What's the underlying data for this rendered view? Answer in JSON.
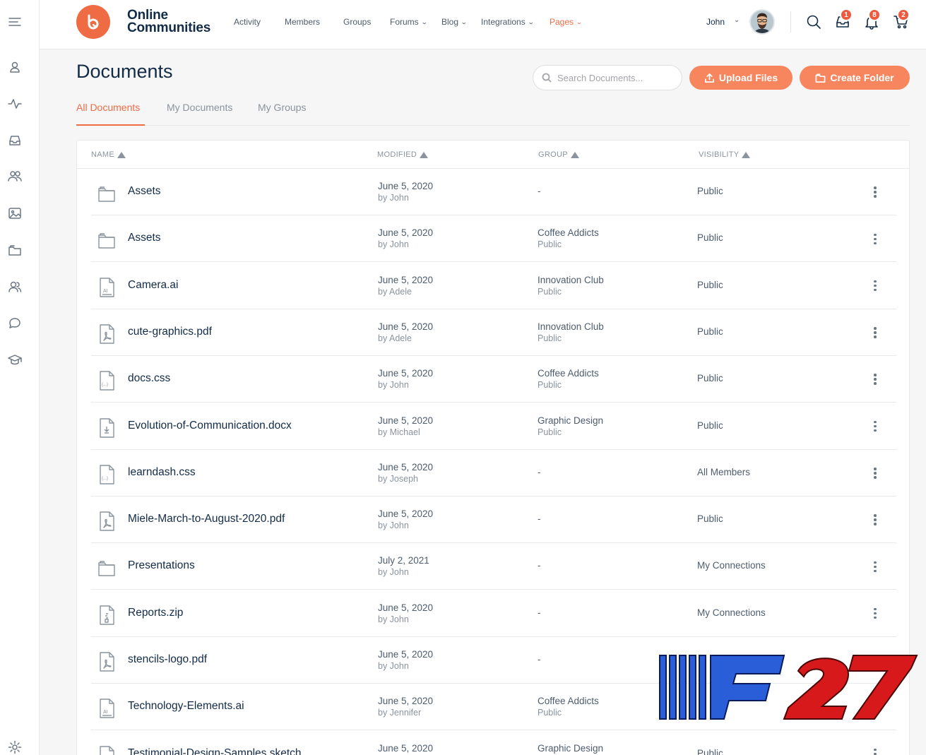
{
  "sidebar": {
    "items": [
      {
        "name": "menu-toggle-icon"
      },
      {
        "name": "profile-icon"
      },
      {
        "name": "activity-icon"
      },
      {
        "name": "inbox-icon"
      },
      {
        "name": "members-icon"
      },
      {
        "name": "photos-icon"
      },
      {
        "name": "folders-icon"
      },
      {
        "name": "connections-icon"
      },
      {
        "name": "forums-icon"
      },
      {
        "name": "courses-icon"
      },
      {
        "name": "settings-icon"
      }
    ]
  },
  "header": {
    "logo_line1": "Online",
    "logo_line2": "Communities",
    "nav": [
      {
        "label": "Activity",
        "dropdown": false,
        "active": false
      },
      {
        "label": "Members",
        "dropdown": false,
        "active": false
      },
      {
        "label": "Groups",
        "dropdown": false,
        "active": false
      },
      {
        "label": "Forums",
        "dropdown": true,
        "active": false
      },
      {
        "label": "Blog",
        "dropdown": true,
        "active": false
      },
      {
        "label": "Integrations",
        "dropdown": true,
        "active": false
      },
      {
        "label": "Pages",
        "dropdown": true,
        "active": true
      }
    ],
    "user_name": "John",
    "badges": {
      "messages": "1",
      "notifications": "8",
      "cart": "2"
    }
  },
  "page": {
    "title": "Documents",
    "search_placeholder": "Search Documents...",
    "upload_label": "Upload Files",
    "create_folder_label": "Create Folder"
  },
  "tabs": [
    {
      "label": "All Documents",
      "active": true
    },
    {
      "label": "My Documents",
      "active": false
    },
    {
      "label": "My Groups",
      "active": false
    }
  ],
  "table": {
    "columns": [
      "NAME",
      "MODIFIED",
      "GROUP",
      "VISIBILITY"
    ],
    "rows": [
      {
        "icon": "folder",
        "name": "Assets",
        "date": "June 5, 2020",
        "by": "by John",
        "group": "-",
        "group_vis": "",
        "visibility": "Public"
      },
      {
        "icon": "folder",
        "name": "Assets",
        "date": "June 5, 2020",
        "by": "by John",
        "group": "Coffee Addicts",
        "group_vis": "Public",
        "visibility": "Public"
      },
      {
        "icon": "ai",
        "name": "Camera.ai",
        "date": "June 5, 2020",
        "by": "by Adele",
        "group": "Innovation Club",
        "group_vis": "Public",
        "visibility": "Public"
      },
      {
        "icon": "pdf",
        "name": "cute-graphics.pdf",
        "date": "June 5, 2020",
        "by": "by Adele",
        "group": "Innovation Club",
        "group_vis": "Public",
        "visibility": "Public"
      },
      {
        "icon": "code",
        "name": "docs.css",
        "date": "June 5, 2020",
        "by": "by John",
        "group": "Coffee Addicts",
        "group_vis": "Public",
        "visibility": "Public"
      },
      {
        "icon": "doc",
        "name": "Evolution-of-Communication.docx",
        "date": "June 5, 2020",
        "by": "by Michael",
        "group": "Graphic Design",
        "group_vis": "Public",
        "visibility": "Public"
      },
      {
        "icon": "code",
        "name": "learndash.css",
        "date": "June 5, 2020",
        "by": "by Joseph",
        "group": "-",
        "group_vis": "",
        "visibility": "All Members"
      },
      {
        "icon": "pdf",
        "name": "Miele-March-to-August-2020.pdf",
        "date": "June 5, 2020",
        "by": "by John",
        "group": "-",
        "group_vis": "",
        "visibility": "Public"
      },
      {
        "icon": "folder",
        "name": "Presentations",
        "date": "July 2, 2021",
        "by": "by John",
        "group": "-",
        "group_vis": "",
        "visibility": "My Connections"
      },
      {
        "icon": "zip",
        "name": "Reports.zip",
        "date": "June 5, 2020",
        "by": "by John",
        "group": "-",
        "group_vis": "",
        "visibility": "My Connections"
      },
      {
        "icon": "pdf",
        "name": "stencils-logo.pdf",
        "date": "June 5, 2020",
        "by": "by John",
        "group": "-",
        "group_vis": "",
        "visibility": ""
      },
      {
        "icon": "ai",
        "name": "Technology-Elements.ai",
        "date": "June 5, 2020",
        "by": "by Jennifer",
        "group": "Coffee Addicts",
        "group_vis": "Public",
        "visibility": ""
      },
      {
        "icon": "sketch",
        "name": "Testimonial-Design-Samples.sketch",
        "date": "June 5, 2020",
        "by": "",
        "group": "Graphic Design",
        "group_vis": "",
        "visibility": "Public"
      }
    ]
  },
  "watermark": {
    "text": "F27"
  },
  "colors": {
    "accent": "#ef6b43",
    "button": "#f7865f",
    "text": "#122b46",
    "muted": "#8a939e"
  }
}
